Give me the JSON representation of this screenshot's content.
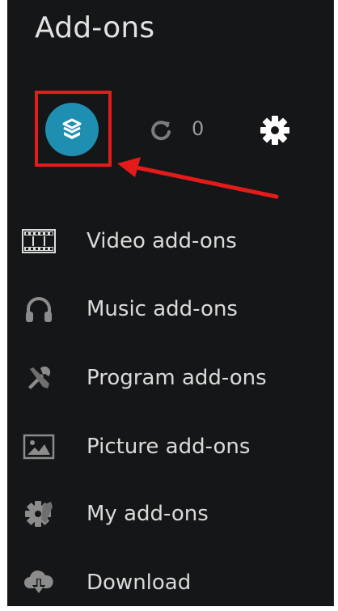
{
  "header": {
    "title": "Add-ons"
  },
  "toolbar": {
    "browser_icon": "open-box-icon",
    "update_icon": "refresh-icon",
    "update_count": "0",
    "settings_icon": "gear-icon"
  },
  "annotation": {
    "highlight_color": "#e31b1b",
    "arrow_color": "#e31b1b"
  },
  "menu": {
    "items": [
      {
        "label": "Video add-ons",
        "icon": "film-strip-icon"
      },
      {
        "label": "Music add-ons",
        "icon": "headphones-icon"
      },
      {
        "label": "Program add-ons",
        "icon": "tools-icon"
      },
      {
        "label": "Picture add-ons",
        "icon": "picture-icon"
      },
      {
        "label": "My add-ons",
        "icon": "gear-puzzle-icon"
      },
      {
        "label": "Download",
        "icon": "cloud-download-icon"
      }
    ]
  },
  "colors": {
    "background": "#151617",
    "accent": "#1e8fb0",
    "text": "#dadada",
    "icon_dim": "#8c8c8c"
  }
}
